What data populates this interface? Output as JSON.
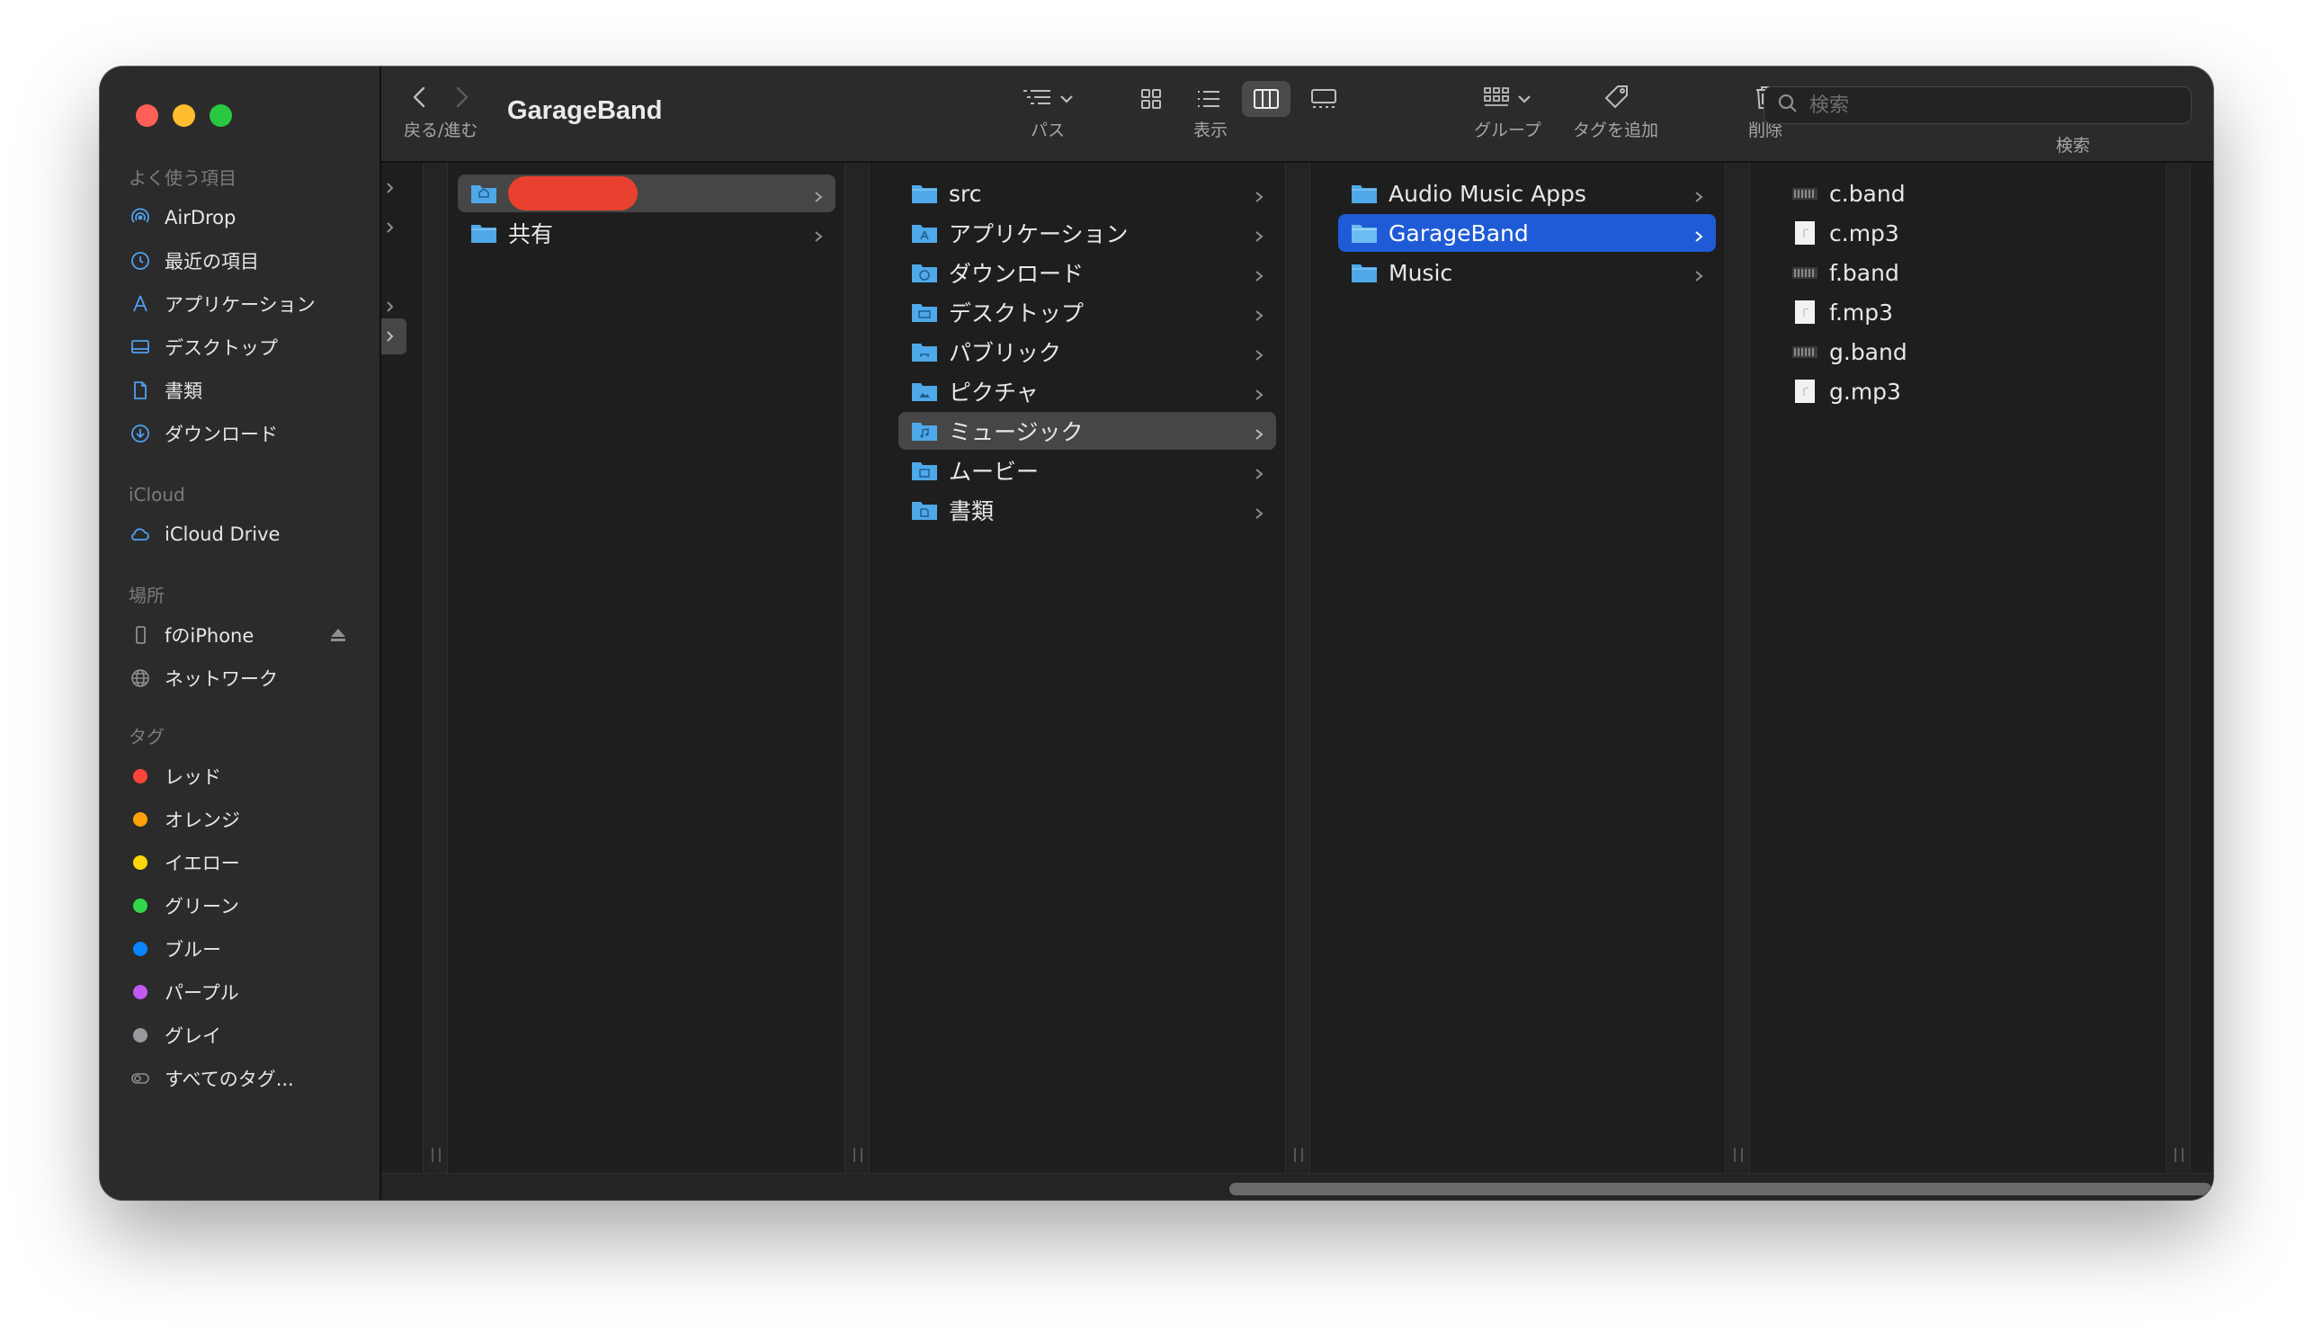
{
  "window_title": "GarageBand",
  "toolbar": {
    "back_forward_label": "戻る/進む",
    "path_label": "パス",
    "view_label": "表示",
    "group_label": "グループ",
    "tag_label": "タグを追加",
    "delete_label": "削除",
    "search_label": "検索",
    "search_placeholder": "検索"
  },
  "sidebar": {
    "favorites_header": "よく使う項目",
    "favorites": [
      {
        "label": "AirDrop",
        "icon": "airdrop-icon"
      },
      {
        "label": "最近の項目",
        "icon": "clock-icon"
      },
      {
        "label": "アプリケーション",
        "icon": "applications-icon"
      },
      {
        "label": "デスクトップ",
        "icon": "desktop-icon"
      },
      {
        "label": "書類",
        "icon": "document-icon"
      },
      {
        "label": "ダウンロード",
        "icon": "download-icon"
      }
    ],
    "icloud_header": "iCloud",
    "icloud": [
      {
        "label": "iCloud Drive",
        "icon": "cloud-icon"
      }
    ],
    "locations_header": "場所",
    "locations": [
      {
        "label": "fのiPhone",
        "icon": "iphone-icon"
      },
      {
        "label": "ネットワーク",
        "icon": "globe-icon"
      }
    ],
    "tags_header": "タグ",
    "tags": [
      {
        "label": "レッド",
        "color": "#ff453a"
      },
      {
        "label": "オレンジ",
        "color": "#ff9f0a"
      },
      {
        "label": "イエロー",
        "color": "#ffd60a"
      },
      {
        "label": "グリーン",
        "color": "#32d74b"
      },
      {
        "label": "ブルー",
        "color": "#0a84ff"
      },
      {
        "label": "パープル",
        "color": "#bf5af2"
      },
      {
        "label": "グレイ",
        "color": "#98989d"
      },
      {
        "label": "すべてのタグ...",
        "color": ""
      }
    ]
  },
  "columns": {
    "col1": [
      {
        "label": "",
        "redacted": true
      },
      {
        "label": "共有"
      }
    ],
    "col2": [
      {
        "label": "src"
      },
      {
        "label": "アプリケーション"
      },
      {
        "label": "ダウンロード"
      },
      {
        "label": "デスクトップ"
      },
      {
        "label": "パブリック"
      },
      {
        "label": "ピクチャ"
      },
      {
        "label": "ミュージック"
      },
      {
        "label": "ムービー"
      },
      {
        "label": "書類"
      }
    ],
    "col3": [
      {
        "label": "Audio Music Apps"
      },
      {
        "label": "GarageBand"
      },
      {
        "label": "Music"
      }
    ],
    "col4": [
      {
        "label": "c.band",
        "kind": "band"
      },
      {
        "label": "c.mp3",
        "kind": "mp3"
      },
      {
        "label": "f.band",
        "kind": "band"
      },
      {
        "label": "f.mp3",
        "kind": "mp3"
      },
      {
        "label": "g.band",
        "kind": "band"
      },
      {
        "label": "g.mp3",
        "kind": "mp3"
      }
    ]
  },
  "colors": {
    "accent_selection": "#1f5bd6",
    "folder_blue": "#4fa8e8"
  }
}
